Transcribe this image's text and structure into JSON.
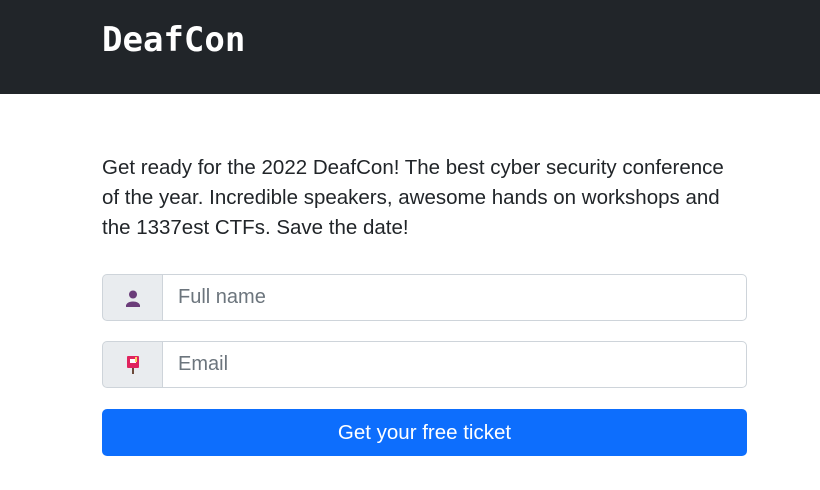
{
  "navbar": {
    "brand": "DeafCon",
    "background": "#212529"
  },
  "intro": {
    "text": "Get ready for the 2022 DeafCon! The best cyber security conference of the year. Incredible speakers, awesome hands on workshops and the 1337est CTFs. Save the date!"
  },
  "form": {
    "name_field": {
      "icon": "person-icon",
      "value": "",
      "placeholder": "Full name"
    },
    "email_field": {
      "icon": "postbox-icon",
      "value": "",
      "placeholder": "Email"
    },
    "submit_label": "Get your free ticket",
    "submit_color": "#0d6efd"
  }
}
